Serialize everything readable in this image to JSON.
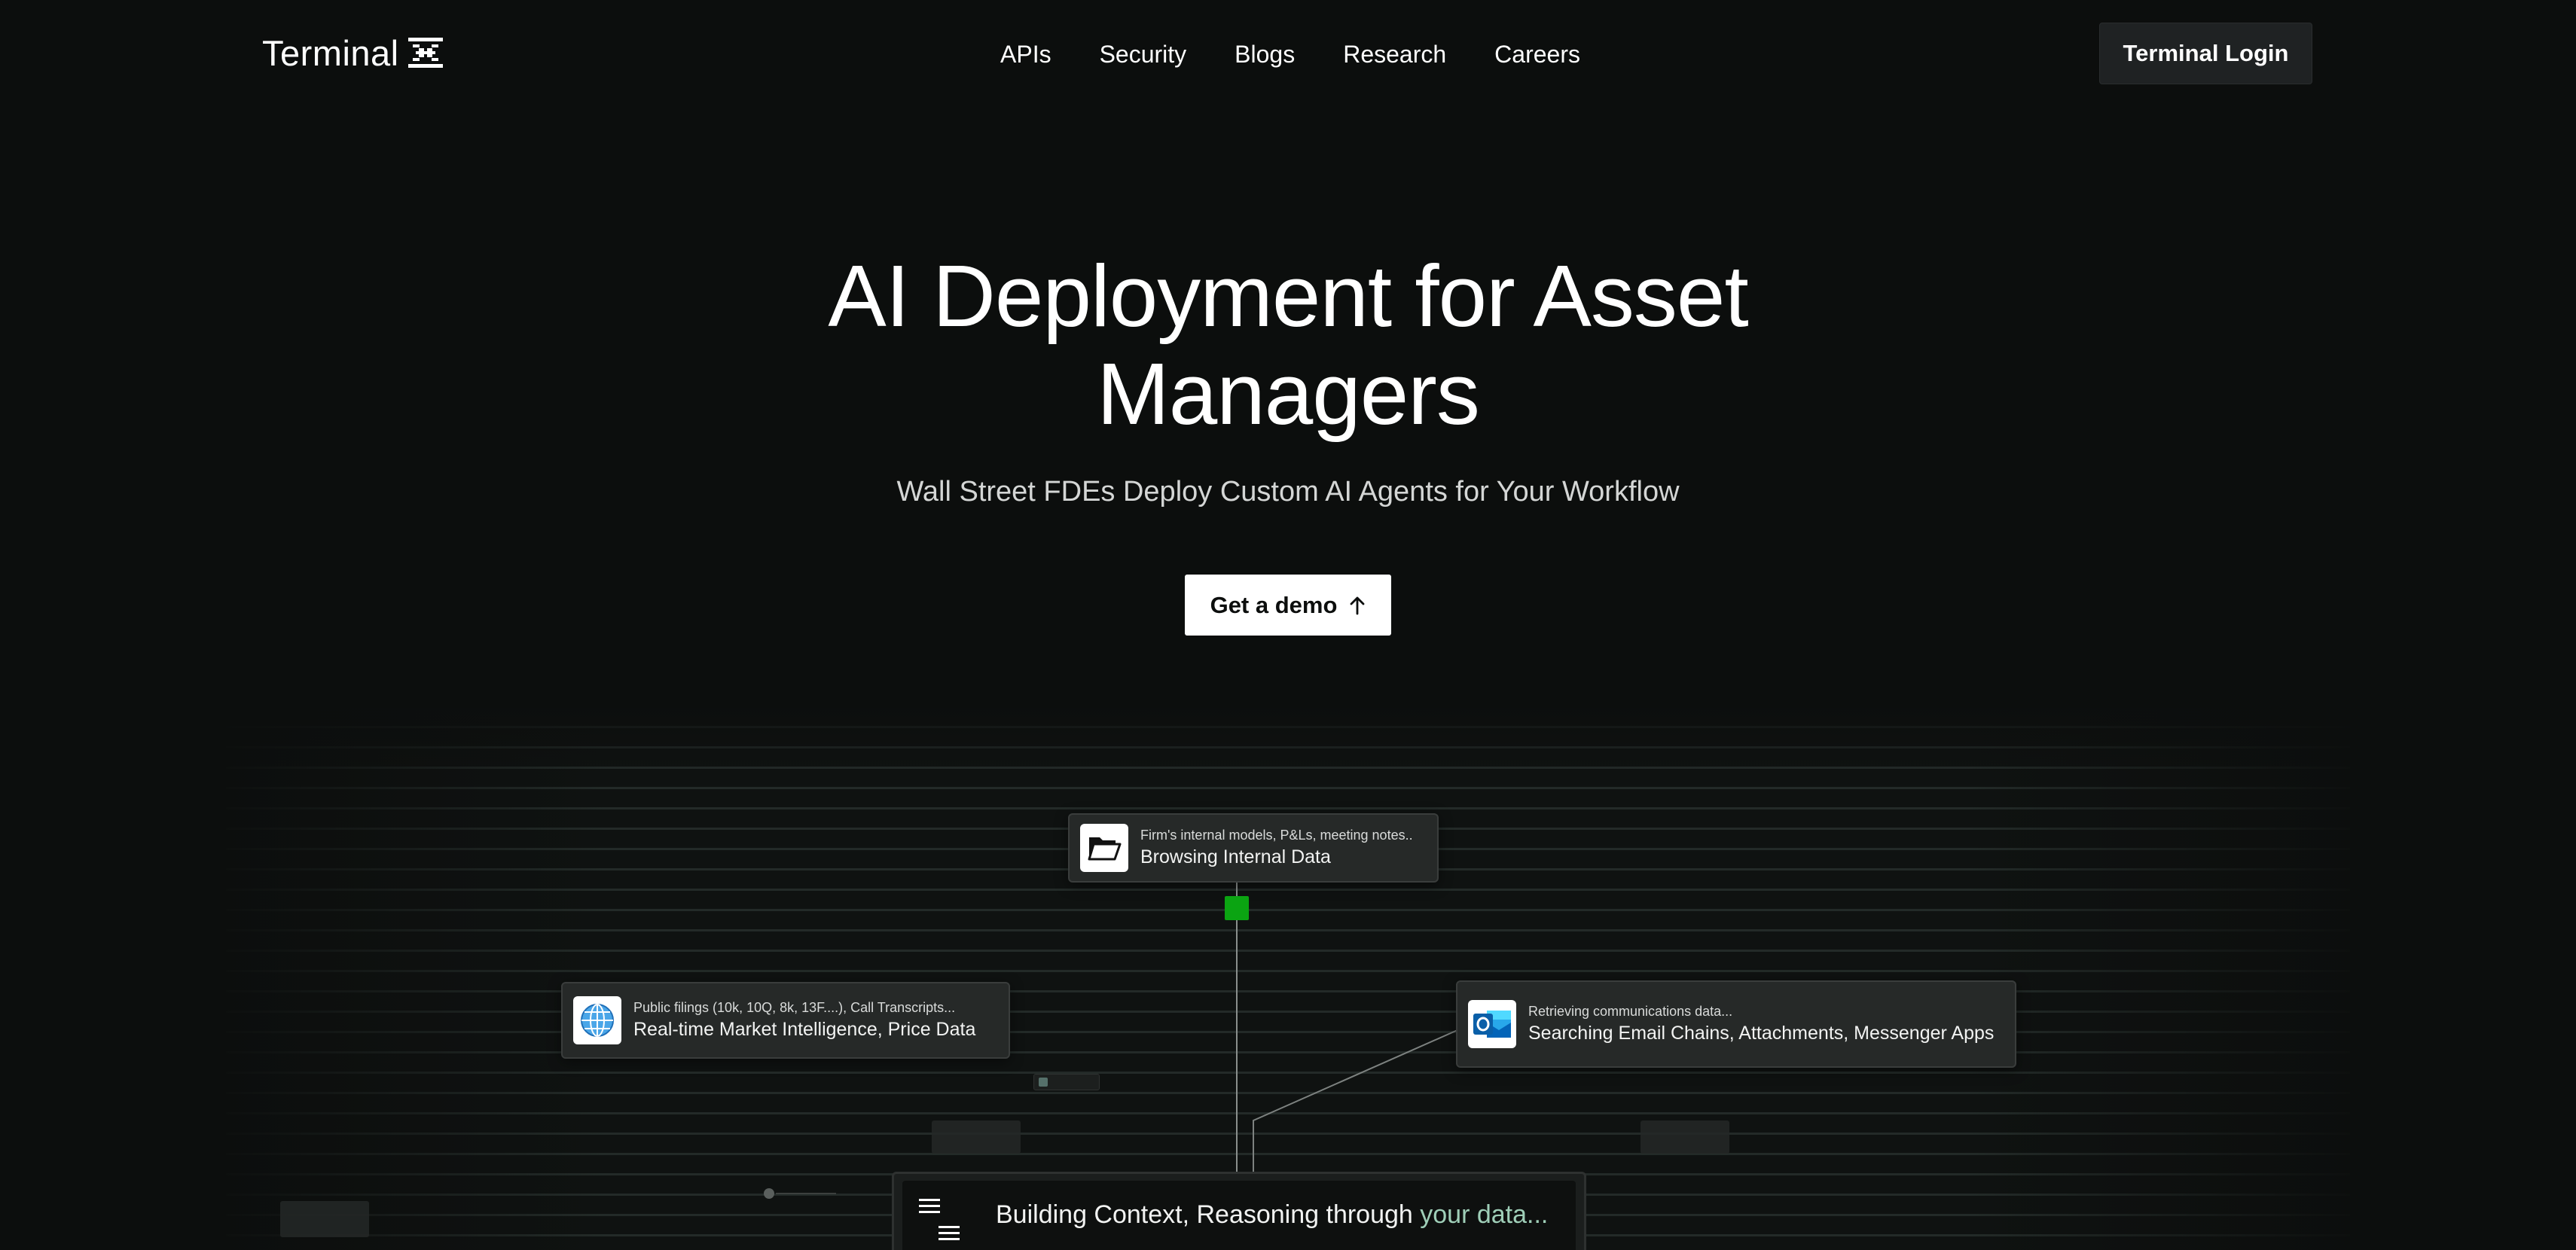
{
  "brand": {
    "name": "Terminal",
    "logo_icon": "terminal-x-logo-icon"
  },
  "nav": {
    "links": [
      "APIs",
      "Security",
      "Blogs",
      "Research",
      "Careers"
    ],
    "login_label": "Terminal Login"
  },
  "hero": {
    "title": "AI Deployment for Asset Managers",
    "subtitle": "Wall Street FDEs Deploy Custom AI Agents for Your Workflow",
    "cta_label": "Get a demo",
    "cta_icon": "arrow-up-icon"
  },
  "workflow": {
    "cards": {
      "internal": {
        "icon": "folder-icon",
        "small": "Firm's internal models, P&Ls, meeting notes..",
        "main": "Browsing Internal Data"
      },
      "public": {
        "icon": "globe-icon",
        "small": "Public filings (10k, 10Q, 8k, 13F....), Call Transcripts...",
        "main": "Real-time Market Intelligence, Price Data"
      },
      "email": {
        "icon": "outlook-icon",
        "small": "Retrieving communications data...",
        "main": "Searching Email Chains, Attachments, Messenger Apps"
      }
    },
    "status": {
      "prefix": "Building Context, Reasoning through ",
      "accent": "your data..."
    },
    "colors": {
      "node_green": "#0ba412",
      "accent_text": "#9fcfb8"
    }
  }
}
